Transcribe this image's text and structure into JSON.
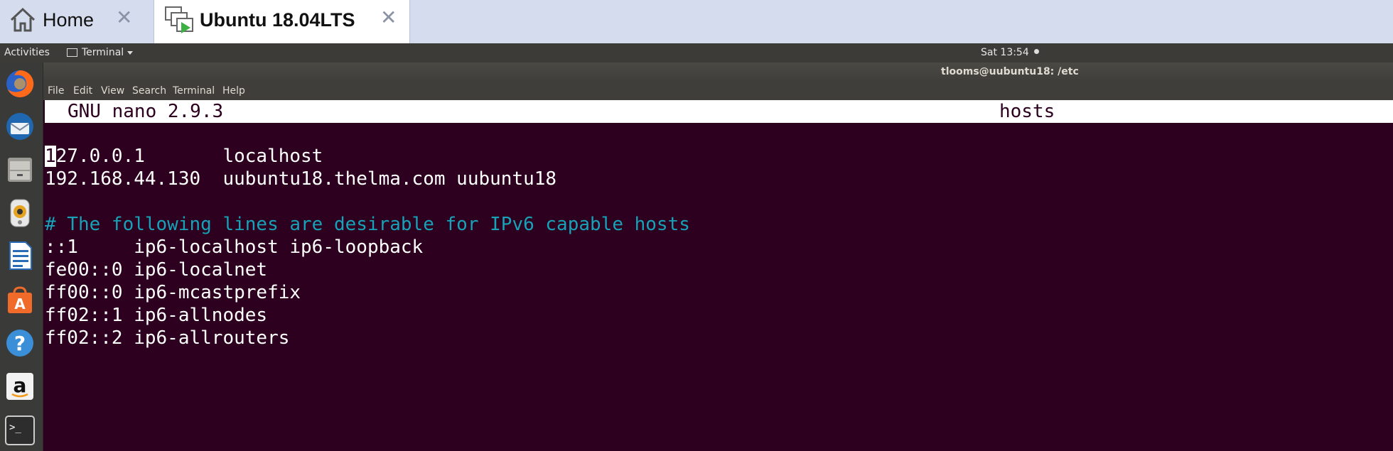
{
  "tabs": [
    {
      "label": "Home",
      "icon": "home-icon"
    },
    {
      "label": "Ubuntu 18.04LTS",
      "icon": "vm-icon"
    }
  ],
  "top_panel": {
    "activities": "Activities",
    "app_menu": "Terminal",
    "clock": "Sat 13:54"
  },
  "launcher": [
    "firefox-icon",
    "thunderbird-icon",
    "files-icon",
    "rhythmbox-icon",
    "libreoffice-writer-icon",
    "software-center-icon",
    "help-icon",
    "amazon-icon",
    "terminal-icon"
  ],
  "window": {
    "title": "tlooms@uubuntu18: /etc",
    "menu": [
      "File",
      "Edit",
      "View",
      "Search",
      "Terminal",
      "Help"
    ]
  },
  "nano": {
    "version": "GNU nano 2.9.3",
    "filename": "hosts",
    "lines": [
      {
        "text": "27.0.0.1       localhost",
        "cursor": "1"
      },
      {
        "text": "192.168.44.130  uubuntu18.thelma.com uubuntu18"
      },
      {
        "text": ""
      },
      {
        "text": "# The following lines are desirable for IPv6 capable hosts",
        "comment": true
      },
      {
        "text": "::1     ip6-localhost ip6-loopback"
      },
      {
        "text": "fe00::0 ip6-localnet"
      },
      {
        "text": "ff00::0 ip6-mcastprefix"
      },
      {
        "text": "ff02::1 ip6-allnodes"
      },
      {
        "text": "ff02::2 ip6-allrouters"
      }
    ]
  },
  "colors": {
    "terminal_bg": "#2c001e",
    "comment": "#17a2b8",
    "tab_strip": "#d4dced"
  }
}
